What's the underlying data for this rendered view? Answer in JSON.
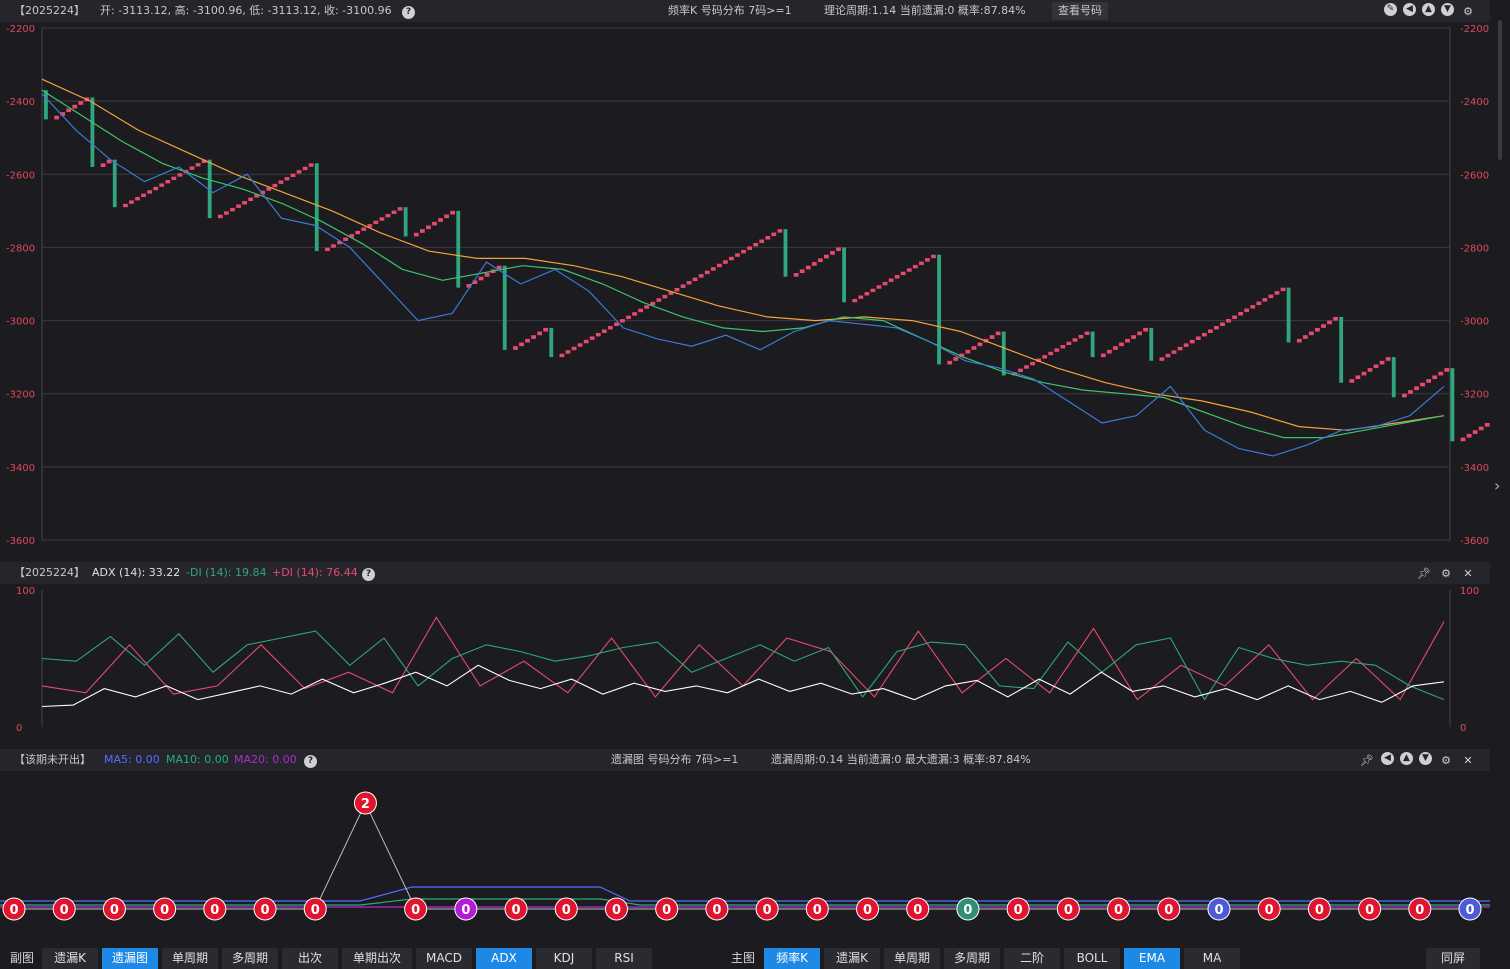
{
  "main_header": {
    "code": "【2025224】",
    "ohlc": "开: -3113.12, 高: -3100.96, 低: -3113.12, 收: -3100.96",
    "center": "频率K  号码分布  7码>=1",
    "stats": "理论周期:1.14  当前遗漏:0  概率:87.84%",
    "view_button": "查看号码"
  },
  "adx_header": {
    "code": "【2025224】",
    "adx": "ADX (14): 33.22",
    "minus_di": "-DI (14): 19.84",
    "plus_di": "+DI (14): 76.44"
  },
  "miss_header": {
    "code": "【该期未开出】",
    "ma5": "MA5: 0.00",
    "ma10": "MA10: 0.00",
    "ma20": "MA20: 0.00",
    "center": "遗漏图  号码分布  7码>=1",
    "stats": "遗漏周期:0.14  当前遗漏:0  最大遗漏:3  概率:87.84%"
  },
  "colors": {
    "up": "#e84a6e",
    "down": "#2fa67b",
    "ema_fast": "#3a7bd5",
    "ema_mid": "#3cc46a",
    "ema_slow": "#f2a33a",
    "adx": "#ffffff",
    "ma5": "#5a6cff",
    "ma10": "#23b07e",
    "ma20": "#b02cc8"
  },
  "chart_data": [
    {
      "type": "line",
      "name": "main",
      "ylim": [
        -3600,
        -2200
      ],
      "yticks": [
        "-2200",
        "-2400",
        "-2600",
        "-2800",
        "-3000",
        "-3200",
        "-3400",
        "-3600"
      ],
      "close_path": [
        -2370,
        -2450,
        -2390,
        -2580,
        -2560,
        -2690,
        -2560,
        -2720,
        -2570,
        -2810,
        -2690,
        -2770,
        -2700,
        -2910,
        -2850,
        -3080,
        -3020,
        -3100,
        -2750,
        -2880,
        -2800,
        -2950,
        -2820,
        -3120,
        -3030,
        -3150,
        -3030,
        -3100,
        -3020,
        -3110,
        -2910,
        -3060,
        -2990,
        -3170,
        -3100,
        -3210,
        -3130,
        -3330,
        -3260,
        -3360,
        -3260,
        -3330,
        -3100,
        -3300,
        -3220,
        -3430,
        -3280,
        -3370,
        -3290,
        -3460,
        -3280,
        -3330,
        -3190,
        -3370,
        -3110
      ],
      "ema_fast_path": [
        -2380,
        -2480,
        -2560,
        -2620,
        -2580,
        -2650,
        -2600,
        -2720,
        -2740,
        -2800,
        -2900,
        -3000,
        -2980,
        -2840,
        -2900,
        -2860,
        -2920,
        -3020,
        -3050,
        -3070,
        -3040,
        -3080,
        -3030,
        -3000,
        -3010,
        -3020,
        -3060,
        -3110,
        -3130,
        -3160,
        -3220,
        -3280,
        -3260,
        -3180,
        -3300,
        -3350,
        -3370,
        -3340,
        -3300,
        -3290,
        -3260,
        -3180
      ],
      "ema_mid_path": [
        -2370,
        -2440,
        -2510,
        -2570,
        -2610,
        -2640,
        -2680,
        -2730,
        -2790,
        -2860,
        -2890,
        -2870,
        -2850,
        -2860,
        -2900,
        -2950,
        -2990,
        -3020,
        -3030,
        -3020,
        -2990,
        -3000,
        -3050,
        -3100,
        -3140,
        -3170,
        -3190,
        -3200,
        -3210,
        -3250,
        -3290,
        -3320,
        -3320,
        -3300,
        -3280,
        -3260
      ],
      "ema_slow_path": [
        -2340,
        -2400,
        -2480,
        -2540,
        -2600,
        -2650,
        -2700,
        -2760,
        -2810,
        -2830,
        -2830,
        -2850,
        -2880,
        -2920,
        -2960,
        -2990,
        -3000,
        -2990,
        -3000,
        -3030,
        -3080,
        -3130,
        -3170,
        -3200,
        -3220,
        -3250,
        -3290,
        -3300,
        -3280,
        -3260
      ]
    },
    {
      "type": "line",
      "name": "ADX (14)",
      "ylim": [
        0,
        100
      ],
      "yticks": [
        "0",
        "100"
      ],
      "series": [
        {
          "name": "ADX (14)",
          "color": "#ffffff",
          "values": [
            15,
            16,
            28,
            22,
            30,
            20,
            25,
            30,
            24,
            35,
            25,
            32,
            40,
            30,
            45,
            34,
            28,
            35,
            24,
            32,
            26,
            30,
            25,
            35,
            26,
            32,
            24,
            28,
            20,
            30,
            34,
            22,
            35,
            24,
            40,
            26,
            30,
            22,
            28,
            20,
            30,
            20,
            26,
            18,
            30,
            33
          ]
        },
        {
          "name": "-DI (14)",
          "color": "#2fa67b",
          "values": [
            50,
            48,
            66,
            45,
            68,
            40,
            60,
            65,
            70,
            45,
            65,
            30,
            50,
            60,
            55,
            48,
            52,
            58,
            62,
            40,
            50,
            60,
            48,
            58,
            22,
            55,
            62,
            60,
            30,
            28,
            62,
            40,
            60,
            65,
            20,
            58,
            50,
            45,
            48,
            45,
            30,
            20
          ]
        },
        {
          "name": "+DI (14)",
          "color": "#e84a6e",
          "values": [
            30,
            25,
            60,
            24,
            30,
            60,
            28,
            40,
            25,
            80,
            30,
            48,
            25,
            65,
            22,
            60,
            30,
            65,
            55,
            22,
            70,
            25,
            50,
            25,
            72,
            20,
            45,
            30,
            60,
            20,
            50,
            20,
            77
          ]
        }
      ]
    },
    {
      "type": "line",
      "name": "遗漏图",
      "miss_values": [
        0,
        0,
        0,
        0,
        0,
        0,
        0,
        2,
        0,
        0,
        0,
        0,
        0,
        0,
        0,
        0,
        0,
        0,
        0,
        0,
        0,
        0,
        0,
        0,
        0,
        0,
        0,
        0,
        0,
        0
      ],
      "marker_colors": [
        "red",
        "red",
        "red",
        "red",
        "red",
        "red",
        "red",
        "red",
        "red",
        "purple",
        "red",
        "red",
        "red",
        "red",
        "red",
        "red",
        "red",
        "red",
        "red",
        "teal",
        "red",
        "red",
        "red",
        "red",
        "blue",
        "red",
        "red",
        "red",
        "red",
        "blue"
      ]
    }
  ],
  "bottom_tabs_left": [
    {
      "label": "副图",
      "active": false,
      "plain": true
    },
    {
      "label": "遗漏K",
      "active": false
    },
    {
      "label": "遗漏图",
      "active": true
    },
    {
      "label": "单周期",
      "active": false
    },
    {
      "label": "多周期",
      "active": false
    },
    {
      "label": "出次",
      "active": false
    },
    {
      "label": "单期出次",
      "active": false
    },
    {
      "label": "MACD",
      "active": false
    },
    {
      "label": "ADX",
      "active": true
    },
    {
      "label": "KDJ",
      "active": false
    },
    {
      "label": "RSI",
      "active": false
    }
  ],
  "bottom_tabs_right": [
    {
      "label": "主图",
      "active": false,
      "plain": true
    },
    {
      "label": "频率K",
      "active": true
    },
    {
      "label": "遗漏K",
      "active": false
    },
    {
      "label": "单周期",
      "active": false
    },
    {
      "label": "多周期",
      "active": false
    },
    {
      "label": "二阶",
      "active": false
    },
    {
      "label": "BOLL",
      "active": false
    },
    {
      "label": "EMA",
      "active": true
    },
    {
      "label": "MA",
      "active": false
    }
  ],
  "sync_button": "同屏"
}
